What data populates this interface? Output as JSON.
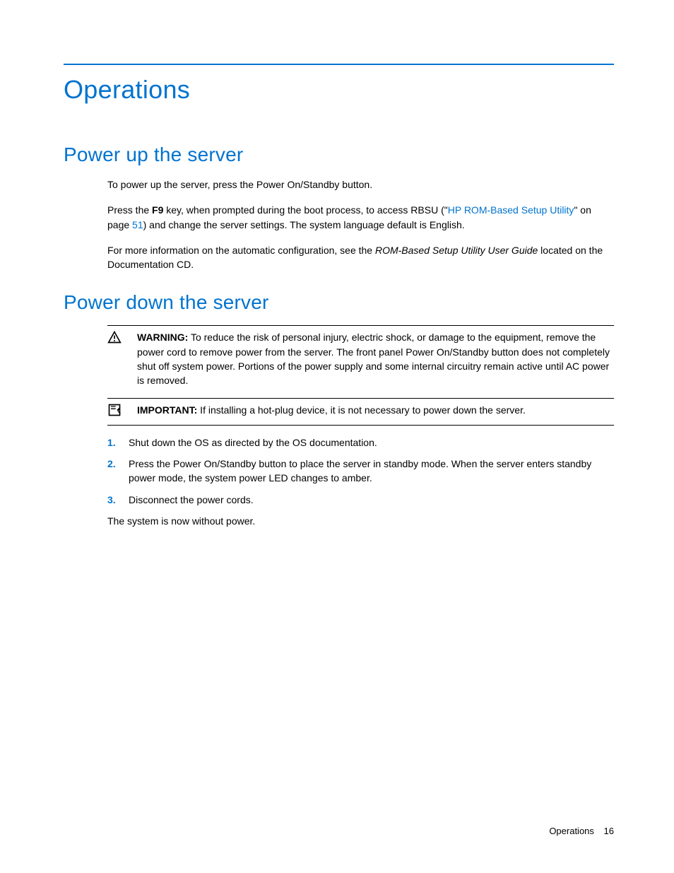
{
  "page_title": "Operations",
  "section1": {
    "heading": "Power up the server",
    "p1": "To power up the server, press the Power On/Standby button.",
    "p2_a": "Press the ",
    "p2_key": "F9",
    "p2_b": " key, when prompted during the boot process, to access RBSU (\"",
    "p2_link": "HP ROM-Based Setup Utility",
    "p2_c": "\" on page ",
    "p2_pagelink": "51",
    "p2_d": ") and change the server settings. The system language default is English.",
    "p3_a": "For more information on the automatic configuration, see the ",
    "p3_italic": "ROM-Based Setup Utility User Guide",
    "p3_b": " located on the Documentation CD."
  },
  "section2": {
    "heading": "Power down the server",
    "warning_label": "WARNING:",
    "warning_text": "  To reduce the risk of personal injury, electric shock, or damage to the equipment, remove the power cord to remove power from the server. The front panel Power On/Standby button does not completely shut off system power. Portions of the power supply and some internal circuitry remain active until AC power is removed.",
    "important_label": "IMPORTANT:",
    "important_text": "  If installing a hot-plug device, it is not necessary to power down the server.",
    "steps": {
      "s1": "Shut down the OS as directed by the OS documentation.",
      "s2": "Press the Power On/Standby button to place the server in standby mode. When the server enters standby power mode, the system power LED changes to amber.",
      "s3": "Disconnect the power cords."
    },
    "closing": "The system is now without power."
  },
  "footer": {
    "section": "Operations",
    "page": "16"
  }
}
